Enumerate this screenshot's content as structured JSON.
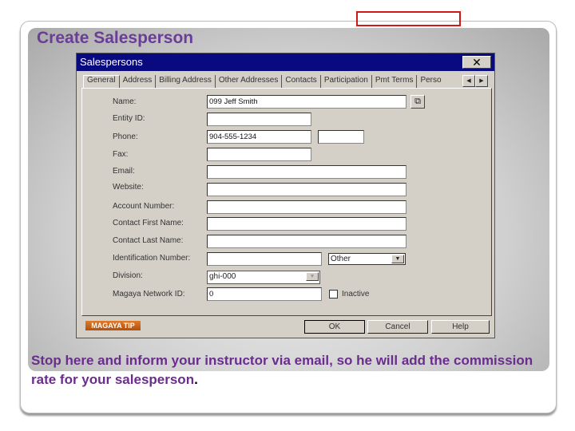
{
  "slide": {
    "title": "Create Salesperson",
    "note": "Stop here and inform your instructor via email, so he will add the commission rate for your salesperson",
    "note_end": "."
  },
  "dialog": {
    "title": "Salespersons",
    "close_label": "✕",
    "tabs": [
      "General",
      "Address",
      "Billing Address",
      "Other Addresses",
      "Contacts",
      "Participation",
      "Pmt Terms",
      "Perso"
    ],
    "active_tab": "General",
    "fields": {
      "name": {
        "label": "Name:",
        "value": "099 Jeff Smith"
      },
      "entity_id": {
        "label": "Entity ID:",
        "value": ""
      },
      "phone": {
        "label": "Phone:",
        "value": "904-555-1234",
        "ext": ""
      },
      "fax": {
        "label": "Fax:",
        "value": ""
      },
      "email": {
        "label": "Email:",
        "value": ""
      },
      "website": {
        "label": "Website:",
        "value": ""
      },
      "account_number": {
        "label": "Account Number:",
        "value": ""
      },
      "contact_first_name": {
        "label": "Contact First Name:",
        "value": ""
      },
      "contact_last_name": {
        "label": "Contact Last Name:",
        "value": ""
      },
      "identification_number": {
        "label": "Identification Number:",
        "value": "",
        "type": "Other"
      },
      "division": {
        "label": "Division:",
        "value": "ghi-000"
      },
      "magaya_network_id": {
        "label": "Magaya Network ID:",
        "value": "0"
      },
      "inactive": {
        "label": "Inactive",
        "checked": false
      }
    },
    "tip_label": "MAGAYA TIP",
    "buttons": {
      "ok": "OK",
      "cancel": "Cancel",
      "help": "Help"
    }
  },
  "colors": {
    "title_purple": "#6a3d98",
    "titlebar": "#0a0a80",
    "highlight_box": "#d01818"
  }
}
